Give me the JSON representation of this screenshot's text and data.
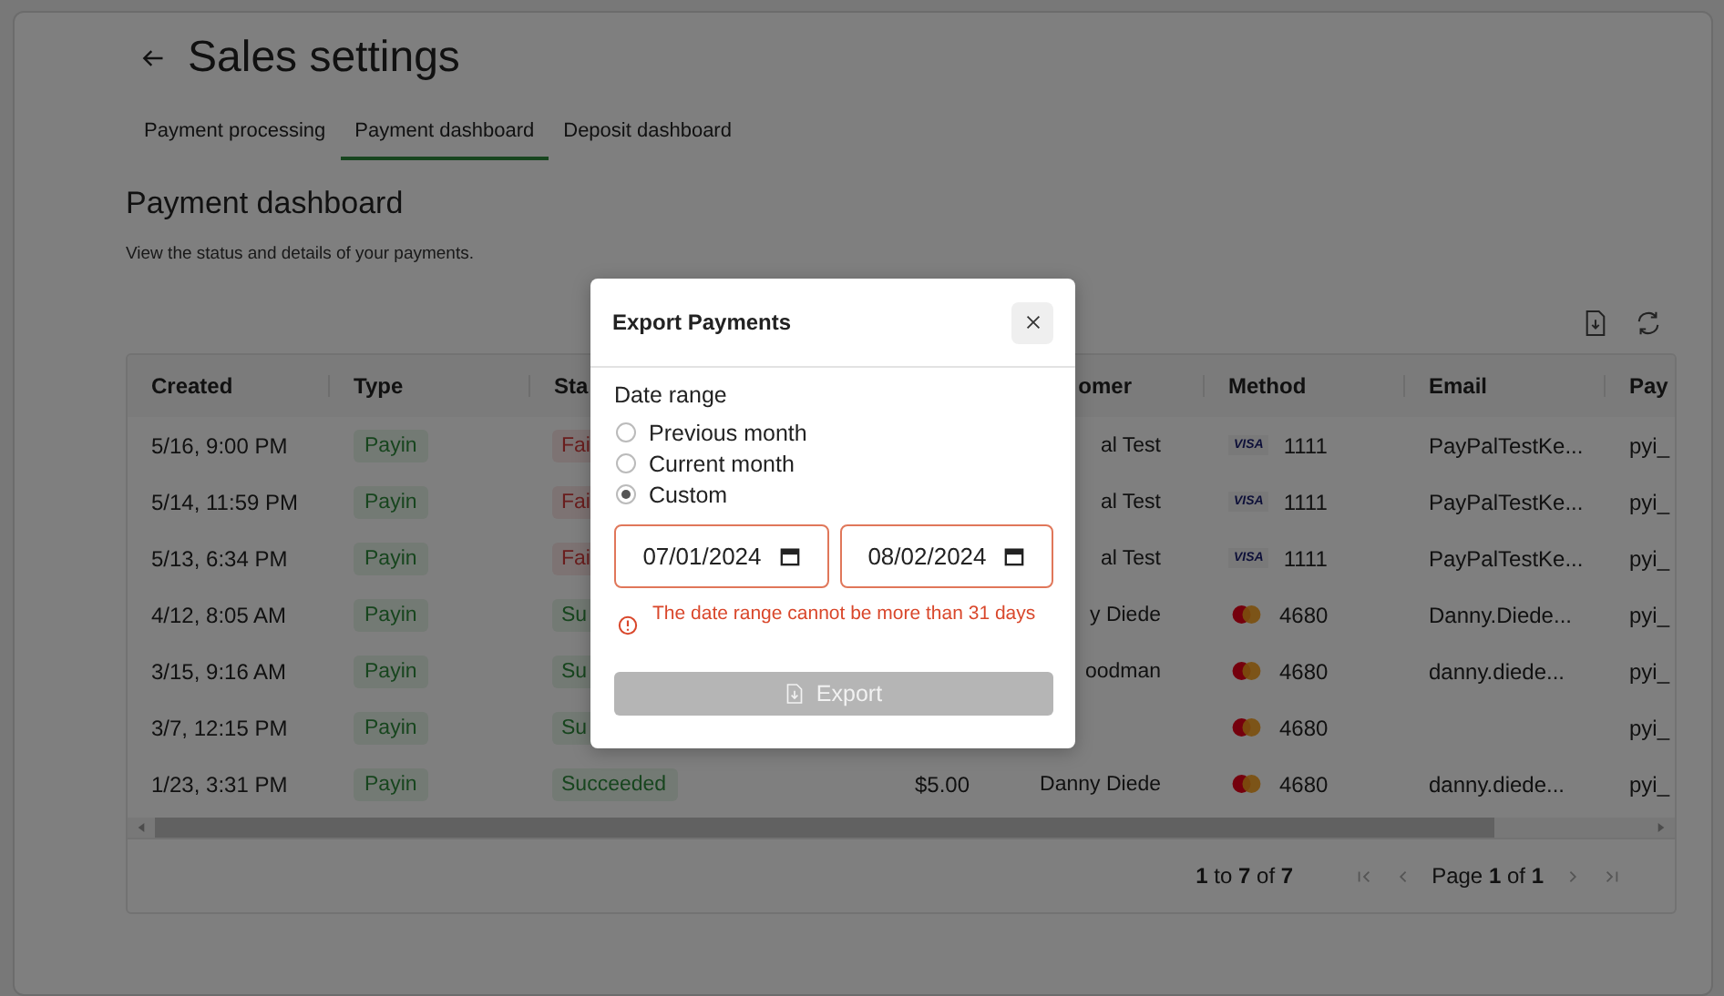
{
  "header": {
    "title": "Sales settings"
  },
  "tabs": [
    {
      "label": "Payment processing",
      "selected": false
    },
    {
      "label": "Payment dashboard",
      "selected": true
    },
    {
      "label": "Deposit dashboard",
      "selected": false
    }
  ],
  "section": {
    "title": "Payment dashboard",
    "subtitle": "View the status and details of your payments."
  },
  "table": {
    "columns": [
      {
        "label": "Created"
      },
      {
        "label": "Type"
      },
      {
        "label": "Sta"
      },
      {},
      {
        "label": "omer"
      },
      {
        "label": "Method"
      },
      {
        "label": "Email"
      },
      {
        "label": "Pay"
      }
    ],
    "rows": [
      {
        "created": "5/16, 9:00 PM",
        "type": "Payin",
        "status": {
          "text": "Fai",
          "kind": "failed"
        },
        "customer": "al Test",
        "method": {
          "kind": "visa",
          "brand": "VISA",
          "last4": "1111"
        },
        "email": "PayPalTestKe...",
        "column_8": "pyi_"
      },
      {
        "created": "5/14, 11:59 PM",
        "type": "Payin",
        "status": {
          "text": "Fai",
          "kind": "failed"
        },
        "customer": "al Test",
        "method": {
          "kind": "visa",
          "brand": "VISA",
          "last4": "1111"
        },
        "email": "PayPalTestKe...",
        "column_8": "pyi_"
      },
      {
        "created": "5/13, 6:34 PM",
        "type": "Payin",
        "status": {
          "text": "Fai",
          "kind": "failed"
        },
        "customer": "al Test",
        "method": {
          "kind": "visa",
          "brand": "VISA",
          "last4": "1111"
        },
        "email": "PayPalTestKe...",
        "column_8": "pyi_"
      },
      {
        "created": "4/12, 8:05 AM",
        "type": "Payin",
        "status": {
          "text": "Su",
          "kind": "succeeded"
        },
        "customer": "y Diede",
        "method": {
          "kind": "mastercard",
          "last4": "4680"
        },
        "email": "Danny.Diede...",
        "column_8": "pyi_"
      },
      {
        "created": "3/15, 9:16 AM",
        "type": "Payin",
        "status": {
          "text": "Su",
          "kind": "succeeded"
        },
        "customer": "oodman",
        "method": {
          "kind": "mastercard",
          "last4": "4680"
        },
        "email": "danny.diede...",
        "column_8": "pyi_"
      },
      {
        "created": "3/7, 12:15 PM",
        "type": "Payin",
        "status": {
          "text": "Su",
          "kind": "succeeded"
        },
        "method": {
          "kind": "mastercard",
          "last4": "4680"
        },
        "column_8": "pyi_"
      },
      {
        "created": "1/23, 3:31 PM",
        "type": "Payin",
        "status": {
          "text": "Succeeded",
          "kind": "succeeded"
        },
        "amount": "$5.00",
        "customer": "Danny Diede",
        "method": {
          "kind": "mastercard",
          "last4": "4680"
        },
        "email": "danny.diede...",
        "column_8": "pyi_"
      }
    ],
    "footer": {
      "range": "**1** to **7** of **7**",
      "page": "Page **1** of **1**"
    }
  },
  "modal": {
    "title": "Export Payments",
    "group_label": "Date range",
    "options": [
      {
        "label": "Previous month",
        "selected": false
      },
      {
        "label": "Current month",
        "selected": false
      },
      {
        "label": "Custom",
        "selected": true
      }
    ],
    "dates": [
      {
        "value": "07/01/2024",
        "error": true
      },
      {
        "value": "08/02/2024",
        "error": true
      }
    ],
    "error": "The date range cannot be more than 31 days",
    "export_button": {
      "label": "Export",
      "disabled": true
    }
  }
}
